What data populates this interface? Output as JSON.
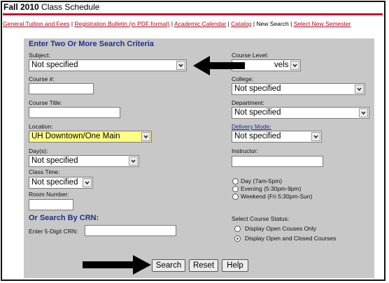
{
  "title": {
    "year": "Fall 2010",
    "rest": "Class Schedule"
  },
  "nav": {
    "tuition": "General Tuition and Fees",
    "bulletin": "Registration Bulletin (in PDF format)",
    "calendar": "Academic Calendar",
    "catalog": "Catalog",
    "new_search": "New Search",
    "select_new": "Select New",
    "semester": "Semester",
    "sep": "|"
  },
  "form": {
    "heading": "Enter Two Or More Search Criteria",
    "subject": {
      "label": "Subject:",
      "value": "Not specified"
    },
    "course_num": {
      "label": "Course #:",
      "value": ""
    },
    "course_title": {
      "label": "Course Title:",
      "value": ""
    },
    "location": {
      "label": "Location:",
      "value": "UH Downtown/One Main"
    },
    "days": {
      "label": "Day(s):",
      "value": "Not specified"
    },
    "class_time": {
      "label": "Class Time:",
      "value": "Not specified"
    },
    "room": {
      "label": "Room Number:",
      "value": ""
    },
    "course_level": {
      "label": "Course Level:",
      "value": "vels"
    },
    "college": {
      "label": "College:",
      "value": "Not specified"
    },
    "department": {
      "label": "Department:",
      "value": "Not specified"
    },
    "delivery": {
      "label": "Delivery Mode:",
      "value": "Not specified"
    },
    "instructor": {
      "label": "Instructor:",
      "value": ""
    },
    "time_radios": [
      "Day (7am-5pm)",
      "Evening (5:30pm-9pm)",
      "Weekend (Fri 5:30pm-Sun)"
    ],
    "crn": {
      "heading": "Or Search By CRN:",
      "label": "Enter 5-Digit CRN:",
      "value": ""
    },
    "status": {
      "label": "Select Course Status:",
      "options": [
        "Display Open Couses Only",
        "Display Open and Closed Courses"
      ],
      "selected_index": 1
    }
  },
  "buttons": {
    "search": "Search",
    "reset": "Reset",
    "help": "Help"
  },
  "colors": {
    "red_bar": "#c8102e",
    "link_red": "#b3001b",
    "heading_blue": "#1f2f8a",
    "panel_gray": "#c8c8c8",
    "highlight_yellow": "#ffff80"
  }
}
